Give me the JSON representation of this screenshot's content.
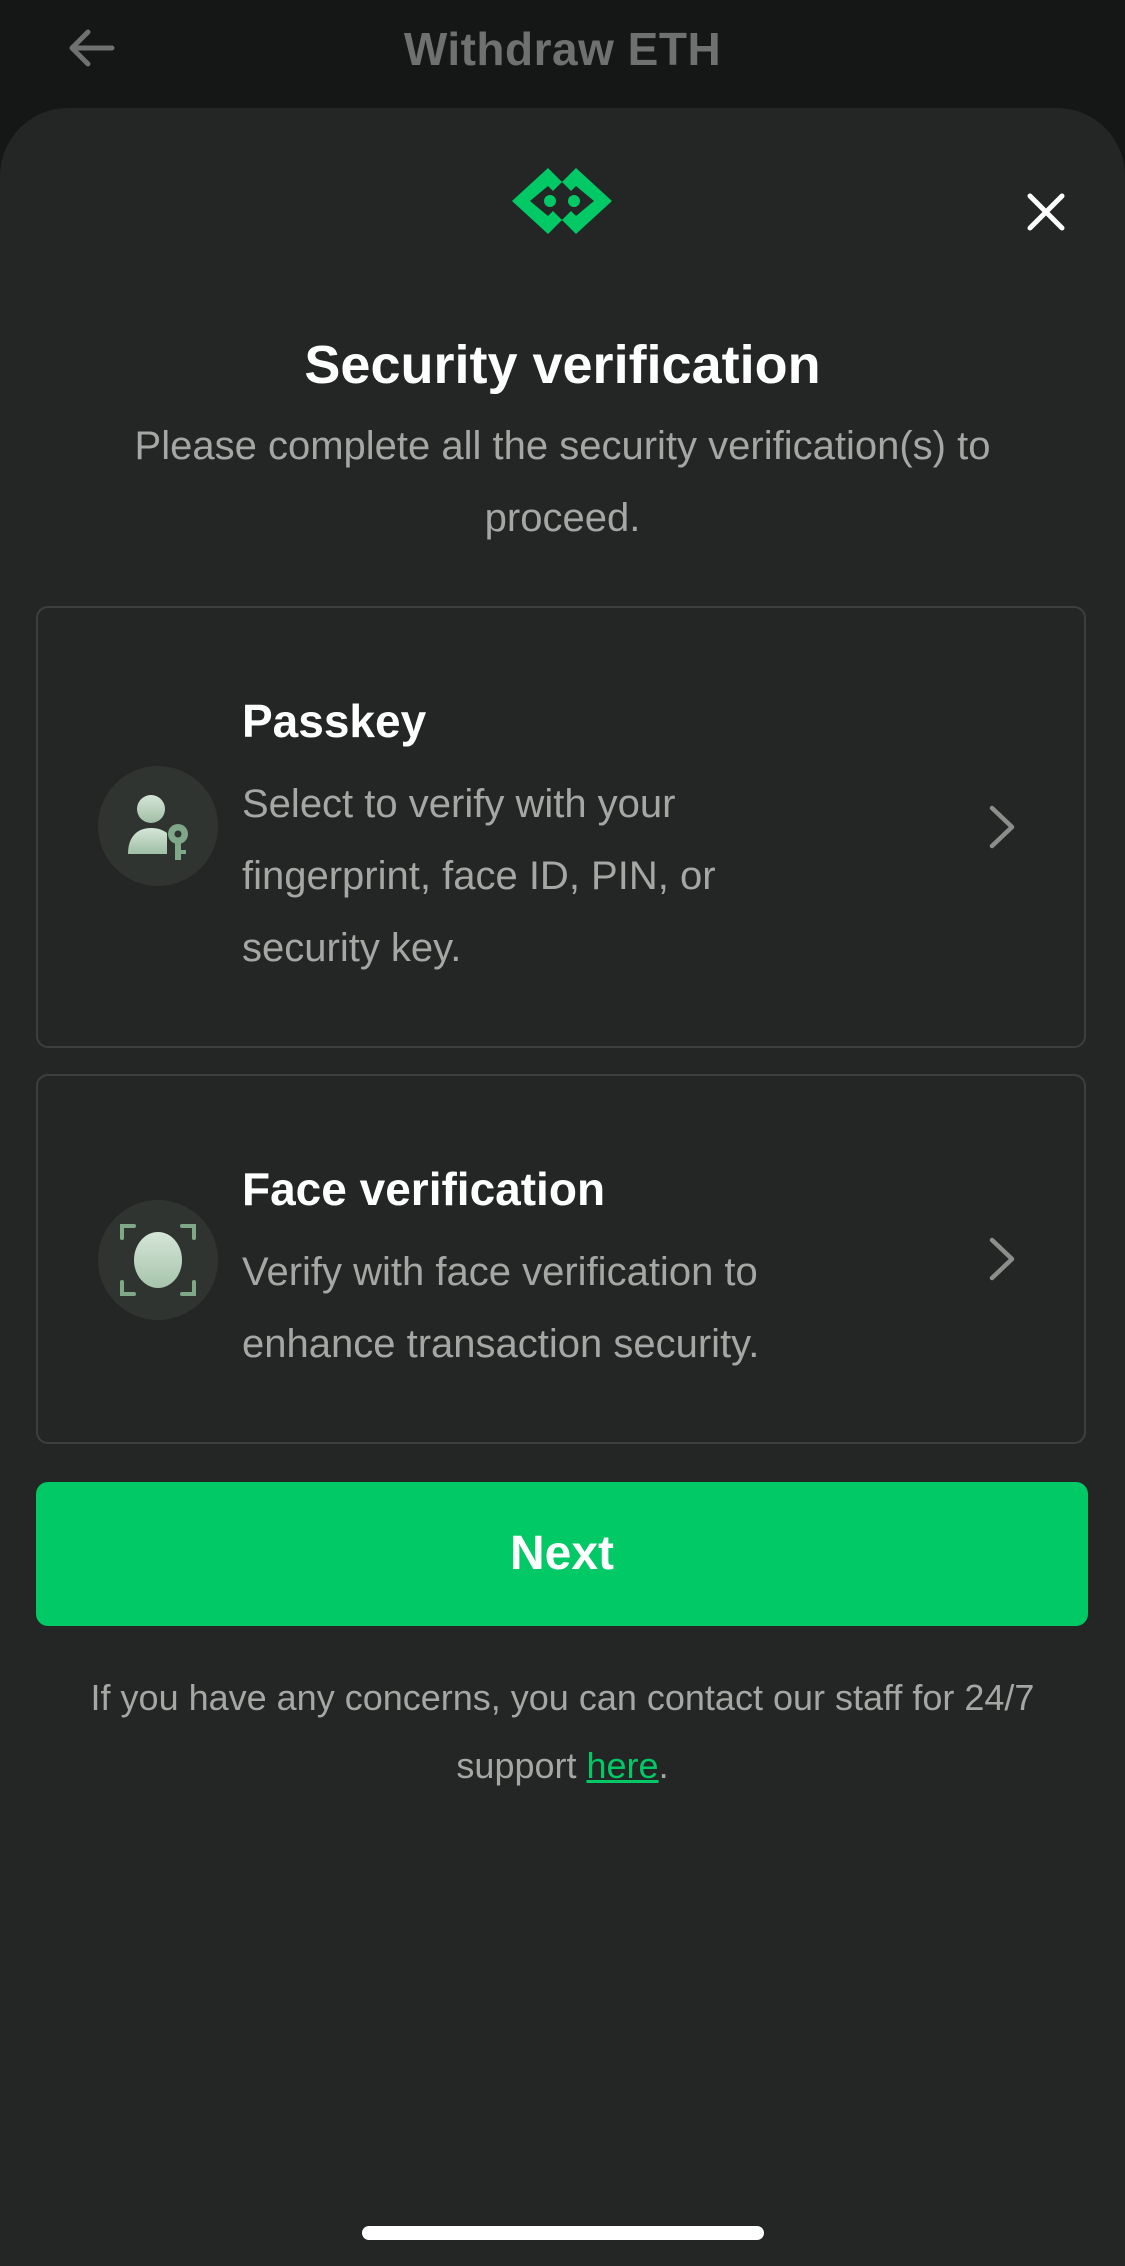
{
  "header": {
    "title": "Withdraw ETH",
    "back_icon": "arrow-left-icon"
  },
  "sheet": {
    "logo_icon": "brand-logo-icon",
    "close_icon": "close-icon",
    "title": "Security verification",
    "subtitle": "Please complete all the security verification(s) to proceed."
  },
  "options": [
    {
      "title": "Passkey",
      "description": "Select to verify with your fingerprint, face ID, PIN, or security key.",
      "icon": "user-key-icon"
    },
    {
      "title": "Face verification",
      "description": "Verify with face verification to enhance transaction security.",
      "icon": "face-scan-icon"
    }
  ],
  "next_button": {
    "label": "Next"
  },
  "support": {
    "text_before": "If you have any concerns, you can contact our staff for 24/7 support ",
    "link_text": "here",
    "text_after": "."
  },
  "colors": {
    "accent": "#00c966",
    "sheet_bg": "#232624",
    "text_primary": "#ffffff",
    "text_secondary": "#a4a8a5"
  }
}
